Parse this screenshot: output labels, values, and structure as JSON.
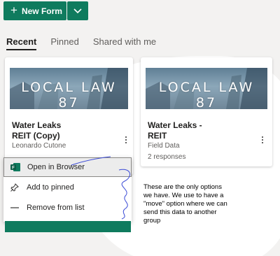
{
  "toolbar": {
    "new_form_label": "New Form",
    "plus_glyph": "+",
    "dropdown_icon": "chevron-down-icon"
  },
  "tabs": [
    {
      "label": "Recent",
      "active": true
    },
    {
      "label": "Pinned",
      "active": false
    },
    {
      "label": "Shared with me",
      "active": false
    }
  ],
  "cards": [
    {
      "banner_text": "LOCAL LAW 87",
      "title_line1": "Water Leaks",
      "title_line2": "REIT (Copy)",
      "owner": "Leonardo Cutone",
      "source": "",
      "responses": ""
    },
    {
      "banner_text": "LOCAL LAW 87",
      "title_line1": "Water Leaks -",
      "title_line2": "REIT",
      "owner": "",
      "source": "Field Data",
      "responses": "2 responses"
    }
  ],
  "context_menu": {
    "items": [
      {
        "label": "Open in Browser",
        "icon": "forms-app-icon",
        "selected": true
      },
      {
        "label": "Add to pinned",
        "icon": "pin-icon",
        "selected": false
      },
      {
        "label": "Remove from list",
        "icon": "minus-icon",
        "selected": false
      }
    ]
  },
  "annotation": {
    "text": "These are the only options we have.  We use to have a \"move\" option where we can send this data to another group"
  },
  "colors": {
    "brand_green": "#0f7b5e",
    "annotation_ink": "#3b4bd6"
  }
}
